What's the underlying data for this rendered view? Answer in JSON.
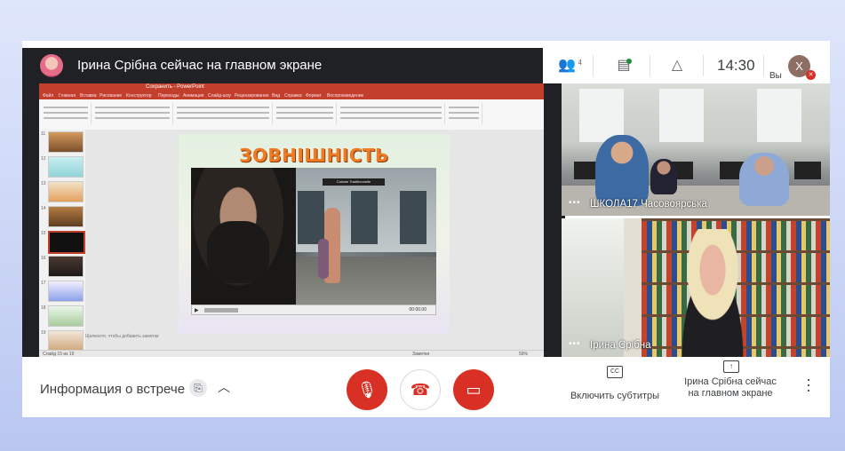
{
  "presenter": {
    "title": "Ірина Срібна сейчас на главном экране"
  },
  "powerpoint": {
    "window_title": "Сохранить - PowerPoint",
    "ribbon_tabs": [
      "Файл",
      "Главная",
      "Вставка",
      "Рисование",
      "Конструктор",
      "Переходы",
      "Анимация",
      "Слайд-шоу",
      "Рецензирование",
      "Вид",
      "Справка",
      "Формат",
      "Воспроизведение"
    ],
    "slide_numbers": [
      "11",
      "12",
      "13",
      "14",
      "15",
      "16",
      "17",
      "18",
      "19"
    ],
    "slide_title": "ЗОВНІШНІСТЬ ОМАНЛИВА",
    "video_sign": "Cuisine Traditionnelle",
    "video_time": "00:00.00",
    "notes_placeholder": "Щелкните, чтобы добавить заметки",
    "status_left": "Слайд 15 из 19",
    "status_right": "Заметки",
    "zoom": "59%"
  },
  "header": {
    "participants_count": "4",
    "time": "14:30",
    "me_initial": "Х",
    "me_label": "Вы"
  },
  "tiles": [
    {
      "name": "ШКОЛА17 Часовоярська"
    },
    {
      "name": "Ірина Срібна"
    }
  ],
  "bottom": {
    "meeting_info": "Информация о встрече",
    "captions_label": "Включить субтитры",
    "presenting_label": "Ірина Срібна сейчас на главном экране"
  },
  "colors": {
    "red": "#d93025",
    "ppt_accent": "#c2402b",
    "slide_title": "#f07a22"
  }
}
